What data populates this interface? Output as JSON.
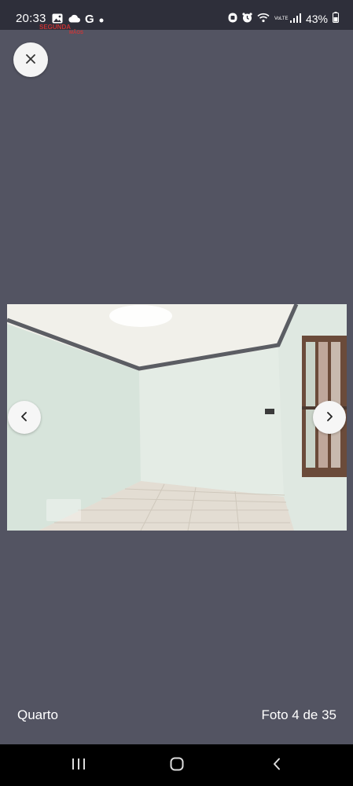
{
  "status_bar": {
    "time": "20:33",
    "left_icons": [
      "image-icon",
      "cloud-icon",
      "google-icon",
      "dot-icon"
    ],
    "google_letter": "G",
    "right_icons": [
      "notification-icon",
      "alarm-icon",
      "wifi-icon",
      "volte-icon",
      "signal-icon",
      "battery-icon"
    ],
    "volte_label": "VoLTE",
    "battery_percent": "43%"
  },
  "watermark": {
    "text": "SEGUNDA",
    "subtext": "MÃOS"
  },
  "viewer": {
    "close_icon": "close-icon",
    "prev_icon": "chevron-left-icon",
    "next_icon": "chevron-right-icon",
    "photo_subject": "room interior",
    "caption": "Quarto",
    "counter": "Foto 4 de 35",
    "current_photo": 4,
    "total_photos": 35
  },
  "system_nav": {
    "recents_icon": "recents-icon",
    "home_icon": "home-icon",
    "back_icon": "back-icon"
  },
  "colors": {
    "background": "#535462",
    "status_bar": "#2e2f3a",
    "nav_bar": "#000000",
    "button_bg": "#f4f4f4",
    "text": "#ffffff"
  }
}
